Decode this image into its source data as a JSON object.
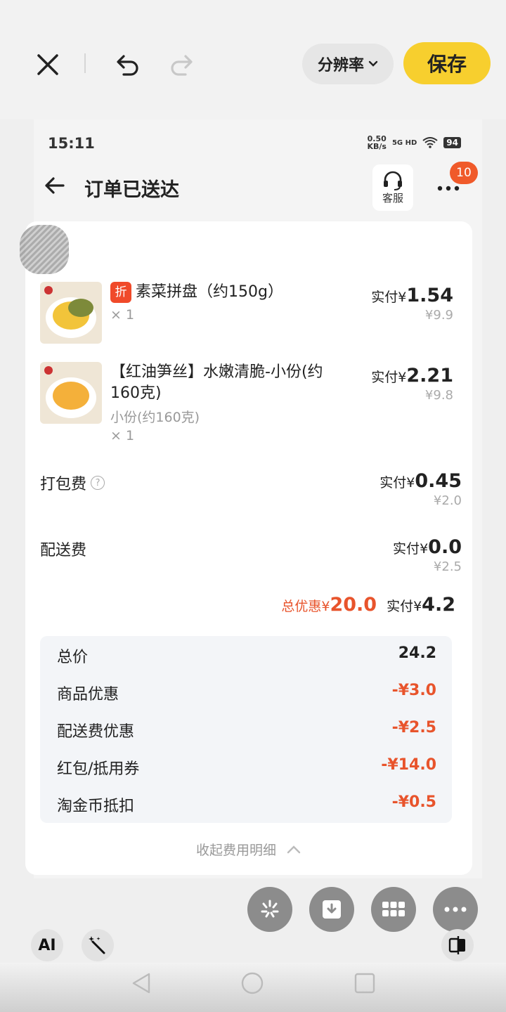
{
  "editor": {
    "resolution_label": "分辨率",
    "save_label": "保存"
  },
  "status": {
    "time": "15:11",
    "speed_value": "0.50",
    "speed_unit": "KB/s",
    "network": "5G HD",
    "battery": "94"
  },
  "nav": {
    "title": "订单已送达",
    "service_label": "客服",
    "badge": "10"
  },
  "items": [
    {
      "tag": "折",
      "name": "素菜拼盘（约150g）",
      "sub": "",
      "qty": "× 1",
      "paid_label": "实付",
      "paid_currency": "¥",
      "paid_value": "1.54",
      "original": "¥9.9"
    },
    {
      "tag": "",
      "name": "【红油笋丝】水嫩清脆-小份(约160克)",
      "sub": "小份(约160克)",
      "qty": "× 1",
      "paid_label": "实付",
      "paid_currency": "¥",
      "paid_value": "2.21",
      "original": "¥9.8"
    }
  ],
  "fees": [
    {
      "label": "打包费",
      "help": "?",
      "paid_label": "实付",
      "paid_currency": "¥",
      "paid_value": "0.45",
      "original": "¥2.0"
    },
    {
      "label": "配送费",
      "help": "",
      "paid_label": "实付",
      "paid_currency": "¥",
      "paid_value": "0.0",
      "original": "¥2.5"
    }
  ],
  "summary": {
    "discount_label": "总优惠¥",
    "discount_value": "20.0",
    "paid_label": "实付¥",
    "paid_value": "4.2"
  },
  "breakdown": [
    {
      "label": "总价",
      "value": "24.2",
      "negative": false
    },
    {
      "label": "商品优惠",
      "value": "-¥3.0",
      "negative": true
    },
    {
      "label": "配送费优惠",
      "value": "-¥2.5",
      "negative": true
    },
    {
      "label": "红包/抵用券",
      "value": "-¥14.0",
      "negative": true
    },
    {
      "label": "淘金币抵扣",
      "value": "-¥0.5",
      "negative": true
    }
  ],
  "collapse_label": "收起费用明细",
  "tools": {
    "ai_label": "AI"
  },
  "colors": {
    "accent_yellow": "#f7cf2e",
    "discount_red": "#e8542c",
    "badge_orange": "#f05a2a"
  }
}
